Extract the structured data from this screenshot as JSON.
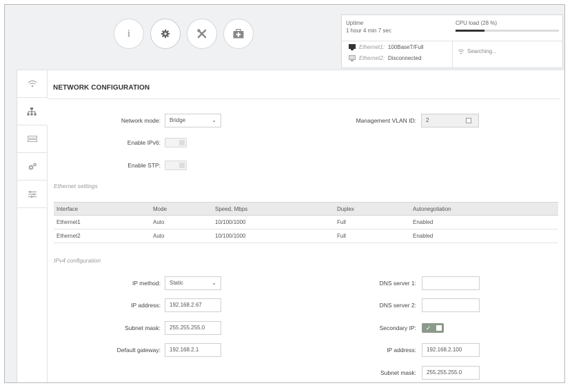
{
  "toolbar": {
    "icons": [
      "info-icon",
      "gear-icon",
      "tools-icon",
      "first-aid-icon"
    ],
    "info_glyph": "i"
  },
  "status": {
    "uptime_label": "Uptime",
    "uptime_value": "1 hour 4 min 7 sec",
    "cpu_label": "CPU load (28 %)",
    "cpu_percent": 28,
    "ethernet1_name": "Ethernet1:",
    "ethernet1_value": "100BaseT/Full",
    "ethernet2_name": "Ethernet2:",
    "ethernet2_value": "Disconnected",
    "wireless_value": "Searching..."
  },
  "sidebar": {
    "items": [
      "wifi-icon",
      "network-icon",
      "ethernet-icon",
      "services-icon",
      "system-icon"
    ]
  },
  "page": {
    "title": "NETWORK CONFIGURATION"
  },
  "network": {
    "mode_label": "Network mode:",
    "mode_value": "Bridge",
    "vlan_label": "Management VLAN ID:",
    "vlan_value": "2",
    "ipv6_label": "Enable IPv6:",
    "stp_label": "Enable STP:"
  },
  "ethernet": {
    "section_title": "Ethernet settings",
    "headers": [
      "Interface",
      "Mode",
      "Speed, Mbps",
      "Duplex",
      "Autonegotiation"
    ],
    "rows": [
      [
        "Ethernet1",
        "Auto",
        "10/100/1000",
        "Full",
        "Enabled"
      ],
      [
        "Ethernet2",
        "Auto",
        "10/100/1000",
        "Full",
        "Enabled"
      ]
    ]
  },
  "ipv4": {
    "section_title": "IPv4 configuration",
    "method_label": "IP method:",
    "method_value": "Static",
    "ip_label": "IP address:",
    "ip_value": "192.168.2.67",
    "mask_label": "Subnet mask:",
    "mask_value": "255.255.255.0",
    "gateway_label": "Default gateway:",
    "gateway_value": "192.168.2.1",
    "dns1_label": "DNS server 1:",
    "dns1_value": "",
    "dns2_label": "DNS server 2:",
    "dns2_value": "",
    "secondary_label": "Secondary IP:",
    "sec_ip_label": "IP address:",
    "sec_ip_value": "192.168.2.100",
    "sec_mask_label": "Subnet mask:",
    "sec_mask_value": "255.255.255.0"
  }
}
